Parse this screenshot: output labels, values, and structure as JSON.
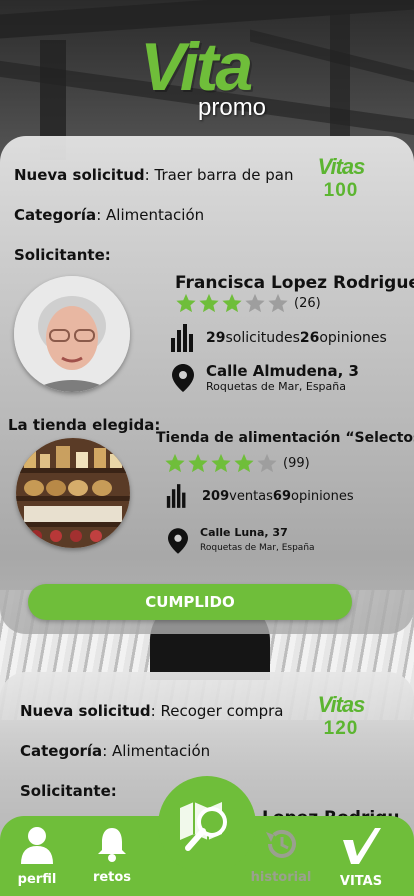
{
  "logo": {
    "main": "Vita",
    "sub": "promo"
  },
  "requests": [
    {
      "title_label": "Nueva solicitud",
      "title_value": ": Traer barra de pan",
      "category_label": "Categoría",
      "category_value": ": Alimentación",
      "requester_label": "Solicitante:",
      "vitas_logo": "Vitas",
      "vitas": "100",
      "requester": {
        "name": "Francisca Lopez Rodriguez",
        "rating": 3,
        "rating_count": "(26)",
        "requests_num": "29",
        "requests_label": " solicitudes ",
        "opinions_num": "26",
        "opinions_label": " opiniones",
        "address": "Calle Almudena, 3",
        "city": "Roquetas de Mar, España"
      },
      "store_label": "La tienda elegida:",
      "store": {
        "name": "Tienda de alimentación “Selectos”",
        "rating": 4,
        "rating_count": "(99)",
        "sales_num": "209",
        "sales_label": " ventas ",
        "opinions_num": "69",
        "opinions_label": " opiniones",
        "address": "Calle Luna, 37",
        "city": "Roquetas de Mar, España"
      },
      "action": "CUMPLIDO"
    },
    {
      "title_label": "Nueva solicitud",
      "title_value": ": Recoger compra",
      "category_label": "Categoría",
      "category_value": ": Alimentación",
      "requester_label": "Solicitante:",
      "vitas_logo": "Vitas",
      "vitas": "120",
      "requester_name_partial": "Lopez Rodrigu"
    }
  ],
  "nav": {
    "profile": "perfil",
    "challenges": "retos",
    "history": "historial",
    "vitas": "VITAS"
  },
  "colors": {
    "accent": "#6fbe3a",
    "inactive": "#9aa08f"
  }
}
